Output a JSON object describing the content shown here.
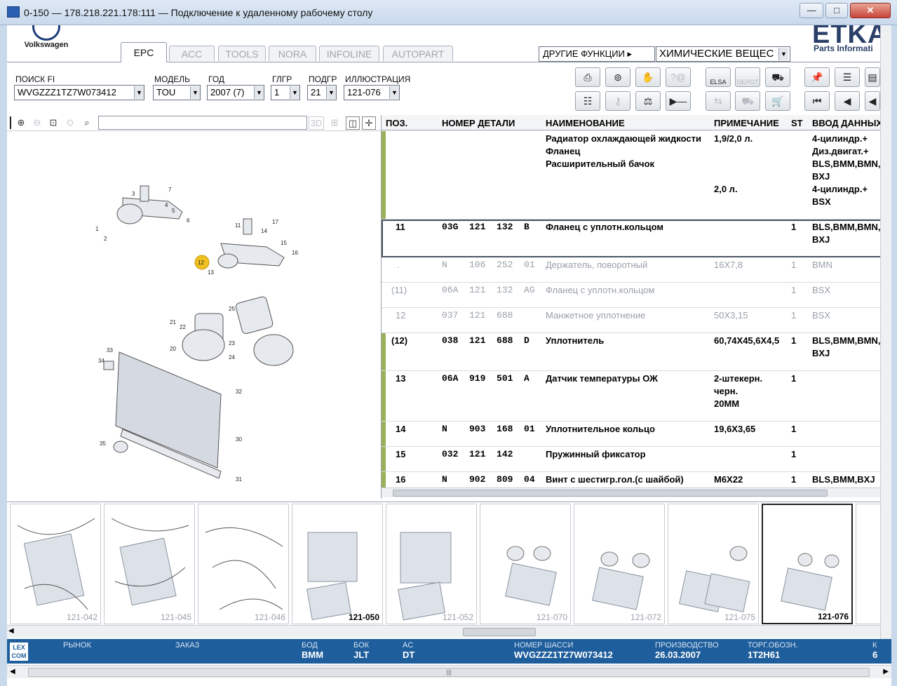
{
  "window": {
    "title": "0-150 — 178.218.221.178:111 — Подключение к удаленному рабочему столу",
    "minimize": "—",
    "maximize": "□",
    "close": "✕"
  },
  "brand": {
    "vw": "Volkswagen",
    "etka": "ETKA",
    "etka_sub": "Parts Informati"
  },
  "tabs": [
    "EPC",
    "ACC",
    "TOOLS",
    "NORA",
    "INFOLINE",
    "AUTOPART"
  ],
  "other_functions": "ДРУГИЕ ФУНКЦИИ ▸",
  "chem": "ХИМИЧЕСКИЕ ВЕЩЕС",
  "filters": {
    "search_label": "ПОИСК FI",
    "search_value": "WVGZZZ1TZ7W073412",
    "model_label": "МОДЕЛЬ",
    "model_value": "TOU",
    "year_label": "ГОД",
    "year_value": "2007 (7)",
    "glgr_label": "ГЛГР",
    "glgr_value": "1",
    "podgr_label": "ПОДГР",
    "podgr_value": "21",
    "illu_label": "ИЛЛЮСТРАЦИЯ",
    "illu_value": "121-076"
  },
  "toolbar": {
    "elsa": "ELSA",
    "depot": "DEPOT"
  },
  "table": {
    "headers": [
      "ПОЗ.",
      "НОМЕР ДЕТАЛИ",
      "НАИМЕНОВАНИЕ",
      "ПРИМЕЧАНИЕ",
      "ST",
      "ВВОД ДАННЫХ"
    ],
    "rows": [
      {
        "pos": "",
        "part": "",
        "name": "Радиатор охлаждающей жидкости\nФланец\nРасширительный бачок",
        "note": "1,9/2,0 л.\n\n\n\n2,0 л.",
        "st": "",
        "data": "4-цилиндр.+\nДиз.двигат.+\nBLS,BMM,BMN,\nBXJ\n4-цилиндр.+\nBSX"
      },
      {
        "pos": "11",
        "part": "03G  121  132  B",
        "name": "Фланец с уплотн.кольцом",
        "note": "",
        "st": "1",
        "data": "BLS,BMM,BMN,\nBXJ"
      },
      {
        "pos": ".",
        "part": "N    106  252  01",
        "name": "Держатель, поворотный",
        "note": "16X7,8",
        "st": "1",
        "data": "BMN"
      },
      {
        "pos": "(11)",
        "part": "06A  121  132  AG",
        "name": "Фланец с уплотн.кольцом",
        "note": "",
        "st": "1",
        "data": "BSX"
      },
      {
        "pos": "12",
        "part": "037  121  688",
        "name": "Манжетное уплотнение",
        "note": "50X3,15",
        "st": "1",
        "data": "BSX"
      },
      {
        "pos": "(12)",
        "part": "038  121  688  D",
        "name": "Уплотнитель",
        "note": "60,74X45,6X4,5",
        "st": "1",
        "data": "BLS,BMM,BMN,\nBXJ"
      },
      {
        "pos": "13",
        "part": "06A  919  501  A",
        "name": "Датчик температуры ОЖ",
        "note": "2-штекерн.\nчерн.\n20MM",
        "st": "1",
        "data": ""
      },
      {
        "pos": "14",
        "part": "N    903  168  01",
        "name": "Уплотнительное кольцо",
        "note": "19,6X3,65",
        "st": "1",
        "data": ""
      },
      {
        "pos": "15",
        "part": "032  121  142",
        "name": "Пружинный фиксатор",
        "note": "",
        "st": "1",
        "data": ""
      },
      {
        "pos": "16",
        "part": "N    902  809  04",
        "name": "Винт с шестигр.гол.(с шайбой)",
        "note": "M6X22",
        "st": "1",
        "data": "BLS,BMM,BXJ"
      }
    ]
  },
  "thumbnails": [
    "121-042",
    "121-045",
    "121-046",
    "121-050",
    "121-052",
    "121-070",
    "121-072",
    "121-075",
    "121-076"
  ],
  "callouts": [
    "1",
    "2",
    "3",
    "4",
    "5",
    "6",
    "7",
    "11",
    "12",
    "13",
    "14",
    "15",
    "16",
    "17",
    "20",
    "21",
    "22",
    "23",
    "24",
    "25",
    "30",
    "31",
    "32",
    "33",
    "34",
    "35"
  ],
  "status": {
    "lex1": "LEX",
    "lex2": "COM",
    "market_label": "РЫНОК",
    "order_label": "ЗАКАЗ",
    "bod_label": "БОД",
    "bod_value": "BMM",
    "bok_label": "БОК",
    "bok_value": "JLT",
    "ac_label": "AC",
    "ac_value": "DT",
    "chassis_label": "НОМЕР ШАССИ",
    "chassis_value": "WVGZZZ1TZ7W073412",
    "prod_label": "ПРОИЗВОДСТВО",
    "prod_value": "26.03.2007",
    "trade_label": "ТОРГ.ОБОЗН.",
    "trade_value": "1T2H61",
    "k_label": "К",
    "k_value": "6"
  }
}
